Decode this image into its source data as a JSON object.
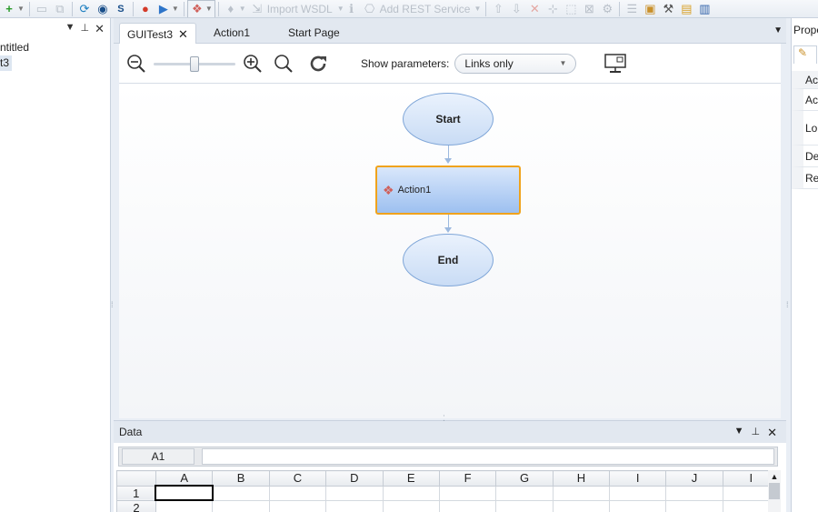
{
  "toolbar": {
    "import_wsdl": "Import WSDL",
    "add_rest_service": "Add REST Service"
  },
  "solution_explorer": {
    "items": [
      "ntitled",
      "t3"
    ]
  },
  "doc_tabs": [
    {
      "label": "GUITest3",
      "active": true,
      "closable": true
    },
    {
      "label": "Action1",
      "active": false
    },
    {
      "label": "Start Page",
      "active": false
    }
  ],
  "canvas_toolbar": {
    "show_parameters_label": "Show parameters:",
    "show_parameters_value": "Links only"
  },
  "flow": {
    "start": "Start",
    "action": "Action1",
    "end": "End"
  },
  "properties_panel": {
    "title": "Prope",
    "rows": [
      "Ac",
      "Ac",
      "Lo",
      "De",
      "Re"
    ]
  },
  "data_panel": {
    "title": "Data",
    "cell_ref": "A1",
    "formula": "",
    "columns": [
      "A",
      "B",
      "C",
      "D",
      "E",
      "F",
      "G",
      "H",
      "I",
      "J",
      "I"
    ],
    "rows": [
      "1",
      "2"
    ]
  },
  "colors": {
    "accent_orange": "#f0a31c",
    "node_blue": "#9dc0f0",
    "panel_bg": "#e2e8f0"
  }
}
